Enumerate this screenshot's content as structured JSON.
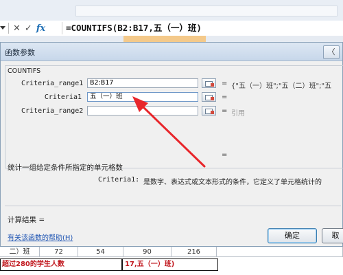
{
  "formula_bar": {
    "cancel_glyph": "✕",
    "enter_glyph": "✓",
    "fx_label": "fx",
    "formula": "=COUNTIFS(B2:B17,五（一）班)"
  },
  "sheet": {
    "row_cells": [
      "二）班",
      "72",
      "54",
      "90",
      "216"
    ],
    "footer_left": "超过280的学生人数",
    "footer_right": "17,五（一）班)"
  },
  "dialog": {
    "title": "函数参数",
    "title_button": "〈",
    "function_name": "COUNTIFS",
    "args": [
      {
        "label": "Criteria_range1",
        "value": "B2:B17",
        "result": "{\"五（一）班\";\"五（二）班\";\"五"
      },
      {
        "label": "Criteria1",
        "value": "五（一）班",
        "result": ""
      },
      {
        "label": "Criteria_range2",
        "value": "",
        "result": "引用"
      }
    ],
    "eq_sign": "=",
    "description": "统计一组给定条件所指定的单元格数",
    "param_label": "Criteria1:",
    "param_desc": "是数字、表达式或文本形式的条件，它定义了单元格统计的",
    "result_label": "计算结果 =",
    "help_link": "有关该函数的帮助(H)",
    "ok_label": "确定",
    "cancel_label": "取"
  },
  "colors": {
    "arrow": "#e8262b",
    "footer_text": "#c0161c",
    "link": "#1f55b3"
  }
}
